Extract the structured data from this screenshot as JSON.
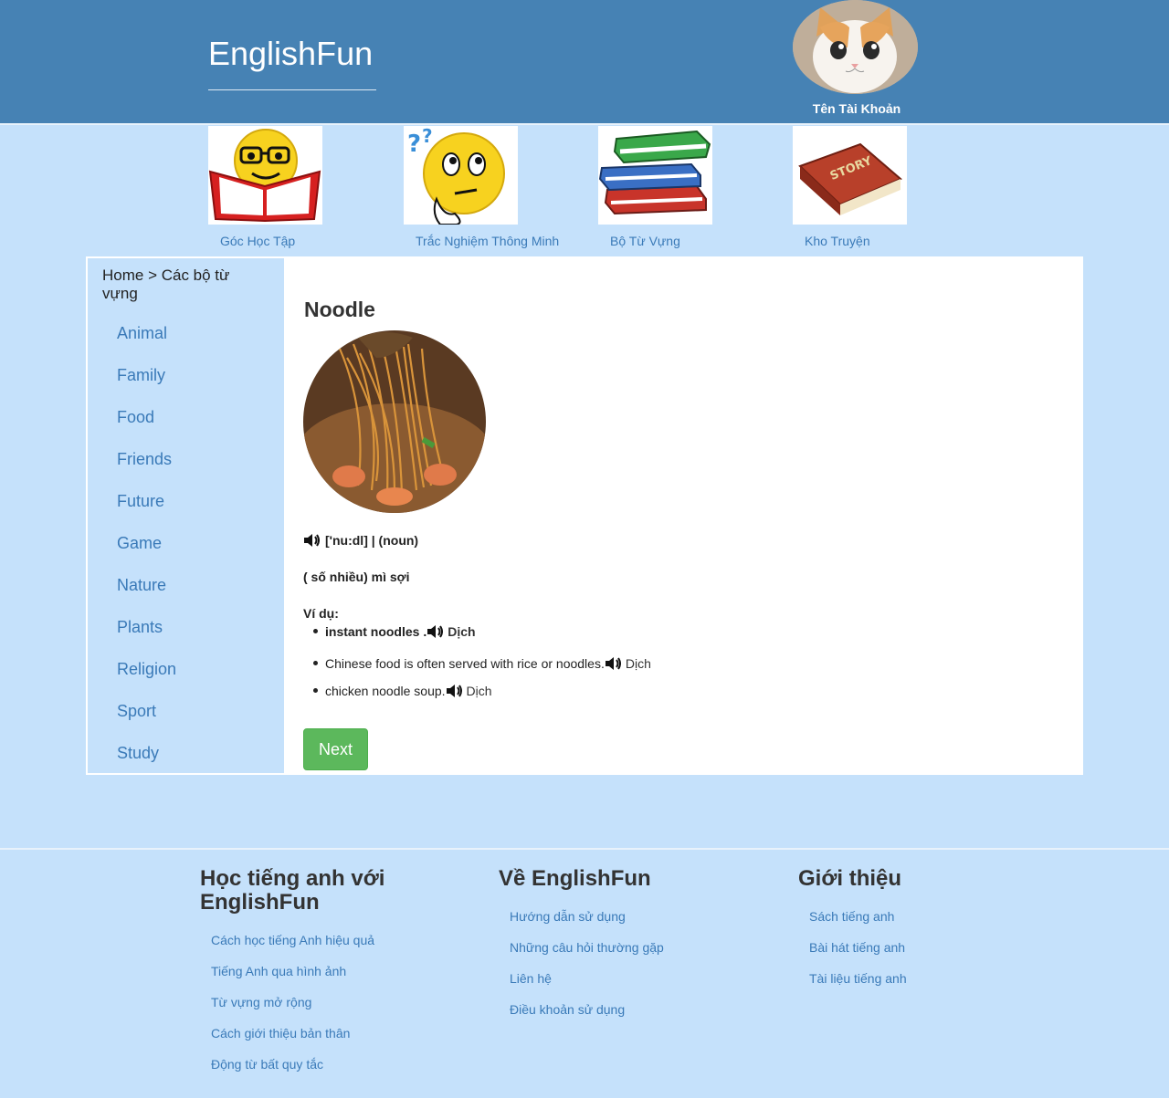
{
  "header": {
    "brand": "EnglishFun",
    "account_name": "Tên Tài Khoản"
  },
  "categories": [
    {
      "label": "Góc Học Tập",
      "icon": "reading-emoji-icon"
    },
    {
      "label": "Trắc Nghiệm Thông Minh",
      "icon": "thinking-emoji-icon"
    },
    {
      "label": "Bộ Từ Vựng",
      "icon": "books-stack-icon"
    },
    {
      "label": "Kho Truyện",
      "icon": "story-book-icon"
    }
  ],
  "sidebar": {
    "breadcrumb": "Home > Các bộ từ vựng",
    "items": [
      "Animal",
      "Family",
      "Food",
      "Friends",
      "Future",
      "Game",
      "Nature",
      "Plants",
      "Religion",
      "Sport",
      "Study"
    ]
  },
  "word": {
    "title": "Noodle",
    "phonetic": "['nu:dl] | (noun)",
    "meaning": "( số nhiều) mì sợi",
    "examples_label": "Ví dụ:",
    "examples": [
      {
        "text": "instant noodles .",
        "translate": "Dịch"
      },
      {
        "text": "Chinese food is often served with rice or noodles.",
        "translate": "Dịch"
      },
      {
        "text": "chicken noodle soup.",
        "translate": "Dịch"
      }
    ],
    "next_label": "Next"
  },
  "footer": {
    "columns": [
      {
        "title": "Học tiếng anh với EnglishFun",
        "links": [
          "Cách học tiếng Anh hiệu quả",
          "Tiếng Anh qua hình ảnh",
          "Từ vựng mở rộng",
          "Cách giới thiệu bản thân",
          "Động từ bất quy tắc"
        ]
      },
      {
        "title": "Về EnglishFun",
        "links": [
          "Hướng dẫn sử dụng",
          "Những câu hỏi thường gặp",
          "Liên hệ",
          "Điều khoản sử dụng"
        ]
      },
      {
        "title": "Giới thiệu",
        "links": [
          "Sách tiếng anh",
          "Bài hát tiếng anh",
          "Tài liệu tiếng anh"
        ]
      }
    ]
  },
  "colors": {
    "header": "#4682b4",
    "background": "#c5e1fb",
    "link": "#3a7ab8",
    "next_button": "#5cb85c"
  }
}
